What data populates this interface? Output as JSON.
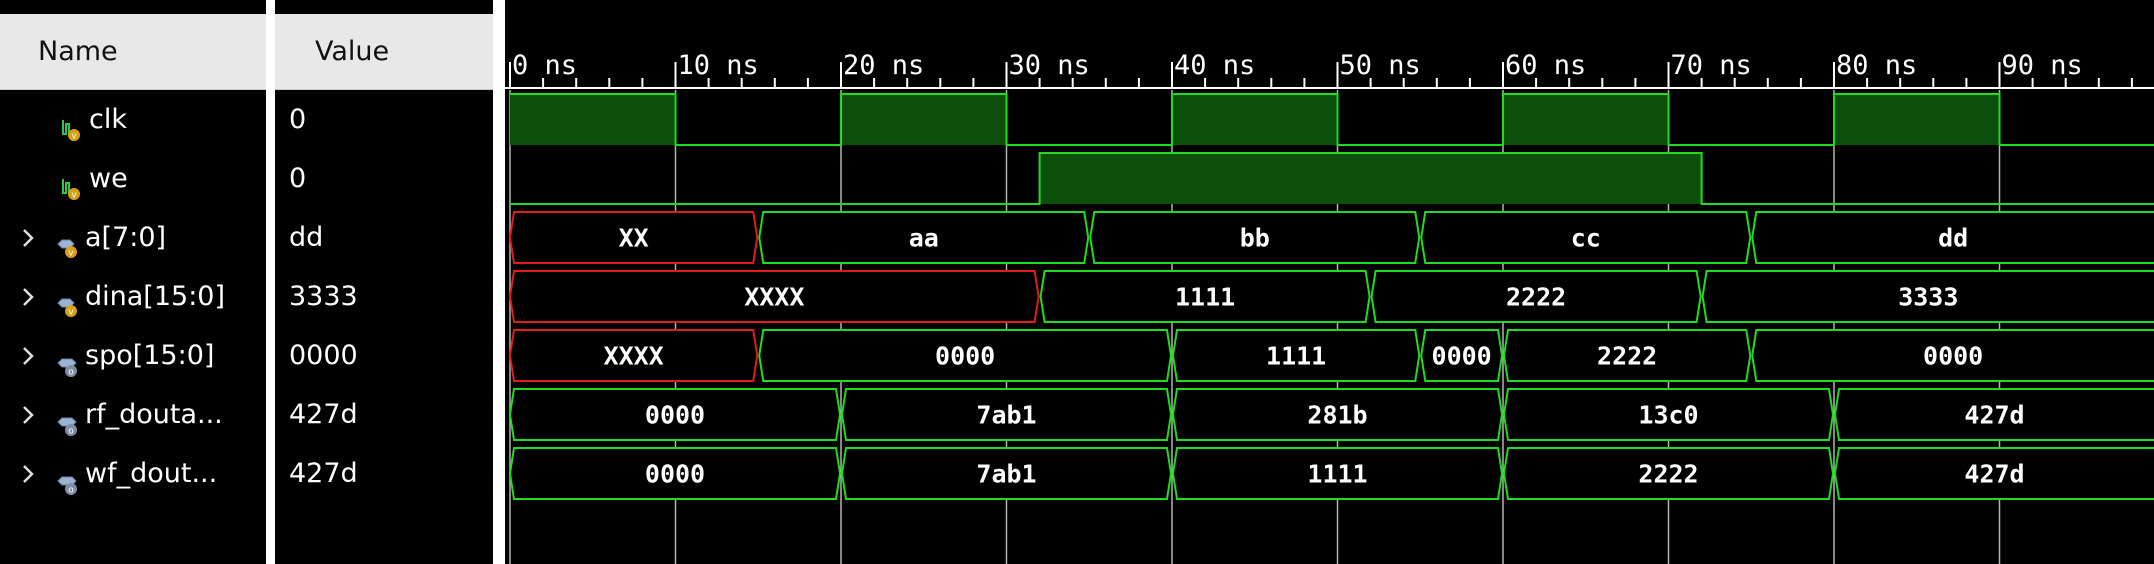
{
  "headers": {
    "name": "Name",
    "value": "Value"
  },
  "time_axis": {
    "unit": "ns",
    "tick_labels": [
      "0 ns",
      "10 ns",
      "20 ns",
      "30 ns",
      "40 ns",
      "50 ns",
      "60 ns",
      "70 ns",
      "80 ns",
      "90 ns"
    ],
    "tick_times": [
      0,
      10,
      20,
      30,
      40,
      50,
      60,
      70,
      80,
      90
    ],
    "visible_range_ns": [
      0,
      99.5
    ]
  },
  "colors": {
    "background": "#000000",
    "wave": "#1edc1e",
    "wave_fill": "#0b4f0b",
    "unknown": "#e01c1c",
    "cursor_line": "#b4b4b4",
    "header_bg": "#e8e8e8",
    "scalar_icon": "#d8a018",
    "vector_icon": "#9bb4d4"
  },
  "signals": [
    {
      "name": "clk",
      "value": "0",
      "type": "scalar",
      "expandable": false,
      "icon": "logic-signal-icon",
      "segments": [
        [
          0,
          10,
          1
        ],
        [
          10,
          20,
          0
        ],
        [
          20,
          30,
          1
        ],
        [
          30,
          40,
          0
        ],
        [
          40,
          50,
          1
        ],
        [
          50,
          60,
          0
        ],
        [
          60,
          70,
          1
        ],
        [
          70,
          80,
          0
        ],
        [
          80,
          90,
          1
        ],
        [
          90,
          99.5,
          0
        ]
      ]
    },
    {
      "name": "we",
      "value": "0",
      "type": "scalar",
      "expandable": false,
      "icon": "logic-signal-icon",
      "segments": [
        [
          0,
          32,
          0
        ],
        [
          32,
          72,
          1
        ],
        [
          72,
          99.5,
          0
        ]
      ]
    },
    {
      "name": "a[7:0]",
      "value": "dd",
      "type": "bus",
      "expandable": true,
      "icon": "vector-signal-icon",
      "segments": [
        [
          0,
          15,
          "XX"
        ],
        [
          15,
          35,
          "aa"
        ],
        [
          35,
          55,
          "bb"
        ],
        [
          55,
          75,
          "cc"
        ],
        [
          75,
          99.5,
          "dd"
        ]
      ]
    },
    {
      "name": "dina[15:0]",
      "value": "3333",
      "type": "bus",
      "expandable": true,
      "icon": "vector-signal-icon",
      "segments": [
        [
          0,
          32,
          "XXXX"
        ],
        [
          32,
          52,
          "1111"
        ],
        [
          52,
          72,
          "2222"
        ],
        [
          72,
          99.5,
          "3333"
        ]
      ]
    },
    {
      "name": "spo[15:0]",
      "value": "0000",
      "type": "bus",
      "expandable": true,
      "icon": "wire-signal-icon",
      "segments": [
        [
          0,
          15,
          "XXXX"
        ],
        [
          15,
          40,
          "0000"
        ],
        [
          40,
          55,
          "1111"
        ],
        [
          55,
          60,
          "0000"
        ],
        [
          60,
          75,
          "2222"
        ],
        [
          75,
          99.5,
          "0000"
        ]
      ]
    },
    {
      "name": "rf_douta...",
      "value": "427d",
      "type": "bus",
      "expandable": true,
      "icon": "wire-signal-icon",
      "segments": [
        [
          0,
          20,
          "0000"
        ],
        [
          20,
          40,
          "7ab1"
        ],
        [
          40,
          60,
          "281b"
        ],
        [
          60,
          80,
          "13c0"
        ],
        [
          80,
          99.5,
          "427d"
        ]
      ]
    },
    {
      "name": "wf_dout...",
      "value": "427d",
      "type": "bus",
      "expandable": true,
      "icon": "wire-signal-icon",
      "segments": [
        [
          0,
          20,
          "0000"
        ],
        [
          20,
          40,
          "7ab1"
        ],
        [
          40,
          60,
          "1111"
        ],
        [
          60,
          80,
          "2222"
        ],
        [
          80,
          99.5,
          "427d"
        ]
      ]
    }
  ]
}
